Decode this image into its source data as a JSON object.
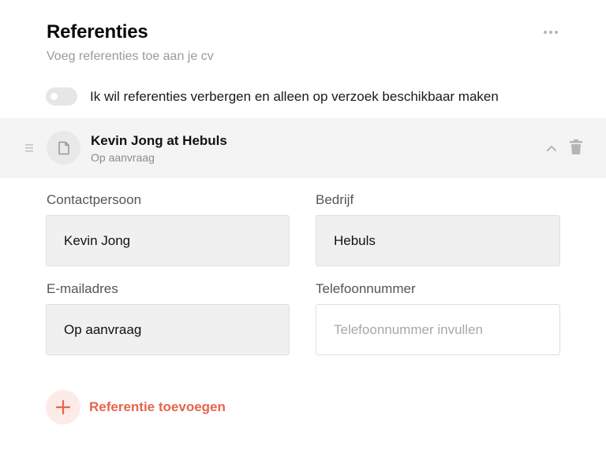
{
  "header": {
    "title": "Referenties",
    "subtitle": "Voeg referenties toe aan je cv",
    "more_icon": "ellipsis-icon"
  },
  "visibility_toggle": {
    "label": "Ik wil referenties verbergen en alleen op verzoek beschikbaar maken",
    "checked": false
  },
  "reference": {
    "title": "Kevin Jong at Hebuls",
    "subtitle": "Op aanvraag",
    "icon": "document-icon",
    "expanded": true
  },
  "form": {
    "contact_label": "Contactpersoon",
    "contact_value": "Kevin Jong",
    "company_label": "Bedrijf",
    "company_value": "Hebuls",
    "email_label": "E-mailadres",
    "email_value": "Op aanvraag",
    "phone_label": "Telefoonnummer",
    "phone_value": "",
    "phone_placeholder": "Telefoonnummer invullen"
  },
  "add_button": {
    "label": "Referentie toevoegen",
    "icon": "plus-icon"
  },
  "colors": {
    "accent": "#e8644c",
    "accent_bg": "#fdebe7",
    "entry_bg": "#f4f4f4",
    "field_bg": "#f0f0f0"
  }
}
